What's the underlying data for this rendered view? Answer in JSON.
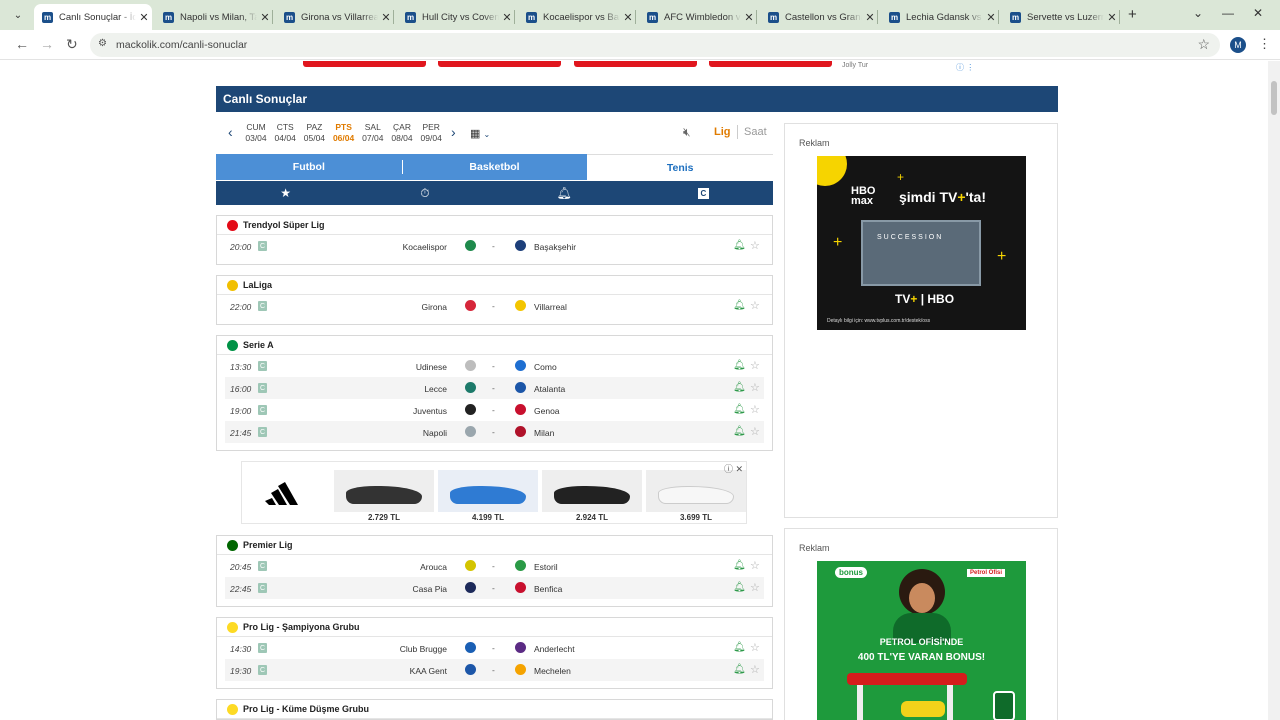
{
  "browser": {
    "tabs": [
      {
        "title": "Canlı Sonuçlar - İddaa"
      },
      {
        "title": "Napoli vs Milan, Ta"
      },
      {
        "title": "Girona vs Villarreal"
      },
      {
        "title": "Hull City vs Coventr"
      },
      {
        "title": "Kocaelispor vs Başa"
      },
      {
        "title": "AFC Wimbledon vs"
      },
      {
        "title": "Castellon vs Grana"
      },
      {
        "title": "Lechia Gdansk vs K"
      },
      {
        "title": "Servette vs Luzern"
      }
    ],
    "url": "mackolik.com/canli-sonuclar",
    "profile_initial": "M"
  },
  "top_ad": {
    "label": "Jolly Tur"
  },
  "page": {
    "title": "Canlı Sonuçlar"
  },
  "days": [
    {
      "name": "CUM",
      "date": "03/04"
    },
    {
      "name": "CTS",
      "date": "04/04"
    },
    {
      "name": "PAZ",
      "date": "05/04"
    },
    {
      "name": "PTS",
      "date": "06/04",
      "selected": true
    },
    {
      "name": "SAL",
      "date": "07/04"
    },
    {
      "name": "ÇAR",
      "date": "08/04"
    },
    {
      "name": "PER",
      "date": "09/04"
    }
  ],
  "view_toggle": {
    "lig": "Lig",
    "saat": "Saat"
  },
  "sports": [
    "Futbol",
    "Basketbol",
    "Tenis"
  ],
  "filters": {
    "c_label": "C"
  },
  "leagues": [
    {
      "name": "Trendyol Süper Lig",
      "flag_color": "#e30a17",
      "matches": [
        {
          "time": "20:00",
          "home": "Kocaelispor",
          "away": "Başakşehir",
          "home_color": "#1f8a4c",
          "away_color": "#1d3f7a"
        }
      ]
    },
    {
      "name": "LaLiga",
      "flag_color": "#f1bf00",
      "matches": [
        {
          "time": "22:00",
          "home": "Girona",
          "away": "Villarreal",
          "home_color": "#d6263a",
          "away_color": "#f3c500"
        }
      ]
    },
    {
      "name": "Serie A",
      "flag_color": "#009246",
      "matches": [
        {
          "time": "13:30",
          "home": "Udinese",
          "away": "Como",
          "home_color": "#bdbdbd",
          "away_color": "#1f6fd1"
        },
        {
          "time": "16:00",
          "home": "Lecce",
          "away": "Atalanta",
          "home_color": "#1d7a6a",
          "away_color": "#1c56a8"
        },
        {
          "time": "19:00",
          "home": "Juventus",
          "away": "Genoa",
          "home_color": "#222222",
          "away_color": "#c8102e"
        },
        {
          "time": "21:45",
          "home": "Napoli",
          "away": "Milan",
          "home_color": "#9aa6ad",
          "away_color": "#b0122a"
        }
      ]
    },
    {
      "name": "Premier Lig",
      "flag_color": "#006600",
      "matches": [
        {
          "time": "20:45",
          "home": "Arouca",
          "away": "Estoril",
          "home_color": "#d4c400",
          "away_color": "#2a9a46"
        },
        {
          "time": "22:45",
          "home": "Casa Pia",
          "away": "Benfica",
          "home_color": "#1d2a5a",
          "away_color": "#c8102e"
        }
      ]
    },
    {
      "name": "Pro Lig - Şampiyona Grubu",
      "flag_color": "#fdda24",
      "matches": [
        {
          "time": "14:30",
          "home": "Club Brugge",
          "away": "Anderlecht",
          "home_color": "#1a5fb4",
          "away_color": "#5b2b84"
        },
        {
          "time": "19:30",
          "home": "KAA Gent",
          "away": "Mechelen",
          "home_color": "#1c56a8",
          "away_color": "#f5a300"
        }
      ]
    },
    {
      "name": "Pro Lig - Küme Düşme Grubu",
      "flag_color": "#fdda24",
      "matches": []
    }
  ],
  "shoe_ad": {
    "prices": [
      "2.729 TL",
      "4.199 TL",
      "2.924 TL",
      "3.699 TL"
    ]
  },
  "side_ads": {
    "label": "Reklam",
    "hbo": {
      "line1": "şimdi TV",
      "line1_suffix": "'ta!",
      "brand": "HBO",
      "brand2": "max",
      "show": "SUCCESSION",
      "footer": "Detaylı bilgi için: www.tvplus.com.tr/destek/oss"
    },
    "po": {
      "badge": "bonus",
      "brand": "Petrol Ofisi",
      "line1": "PETROL OFİSİ'NDE",
      "line2": "400 TL'YE VARAN BONUS!"
    }
  },
  "colors": {
    "navy": "#1d4776",
    "blue": "#4c8fd6",
    "orange": "#e07b00",
    "green": "#2e9a4a"
  }
}
